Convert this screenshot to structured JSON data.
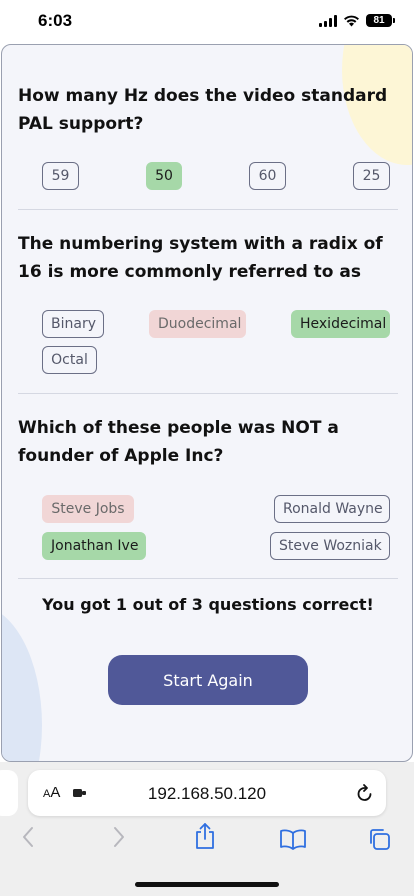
{
  "status": {
    "time": "6:03",
    "battery": "81"
  },
  "questions": [
    {
      "text": "How many Hz does the video standard PAL support?",
      "options": [
        {
          "label": "59",
          "state": "neutral"
        },
        {
          "label": "50",
          "state": "correct"
        },
        {
          "label": "60",
          "state": "neutral"
        },
        {
          "label": "25",
          "state": "neutral"
        }
      ]
    },
    {
      "text": "The numbering system with a radix of 16 is more commonly referred to as",
      "options": [
        {
          "label": "Binary",
          "state": "neutral"
        },
        {
          "label": "Duodecimal",
          "state": "wrong"
        },
        {
          "label": "Hexidecimal",
          "state": "correct"
        },
        {
          "label": "Octal",
          "state": "neutral"
        }
      ]
    },
    {
      "text": "Which of these people was NOT a founder of Apple Inc?",
      "options": [
        {
          "label": "Steve Jobs",
          "state": "wrong"
        },
        {
          "label": "Ronald Wayne",
          "state": "neutral"
        },
        {
          "label": "Jonathan Ive",
          "state": "correct"
        },
        {
          "label": "Steve Wozniak",
          "state": "neutral"
        }
      ]
    }
  ],
  "result_text": "You got 1 out of 3 questions correct!",
  "start_again_label": "Start Again",
  "browser": {
    "text_size_label": "AA",
    "url": "192.168.50.120"
  },
  "colors": {
    "accent_button": "#505898",
    "correct": "#a6d8a8",
    "wrong": "#f1d6d6",
    "panel_background": "#f4f5fa"
  }
}
